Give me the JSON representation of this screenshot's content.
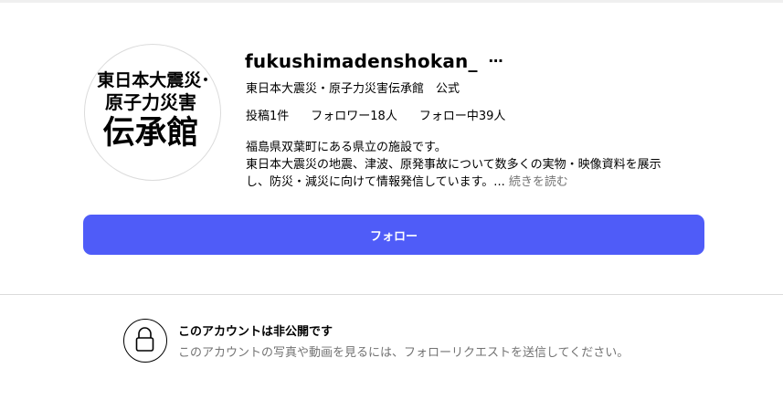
{
  "profile": {
    "username": "fukushimadenshokan_",
    "more_icon": "…",
    "fullname": "東日本大震災・原子力災害伝承館　公式",
    "avatar_logo_lines": [
      "東日本大震災･",
      "原子力災害",
      "伝承館"
    ],
    "stats": {
      "posts": "投稿1件",
      "followers": "フォロワー18人",
      "following": "フォロー中39人"
    },
    "bio_lines": [
      "福島県双葉町にある県立の施設です。",
      "東日本大震災の地震、津波、原発事故について数多くの実物・映像資料を展示",
      "し、防災・減災に向けて情報発信しています。..."
    ],
    "read_more": "続きを読む"
  },
  "follow_button": {
    "label": "フォロー"
  },
  "private": {
    "icon": "lock-icon",
    "title": "このアカウントは非公開です",
    "description": "このアカウントの写真や動画を見るには、フォローリクエストを送信してください。"
  },
  "colors": {
    "accent": "#4f5cf8",
    "secondary_text": "#737373",
    "divider": "#dbdbdb"
  }
}
